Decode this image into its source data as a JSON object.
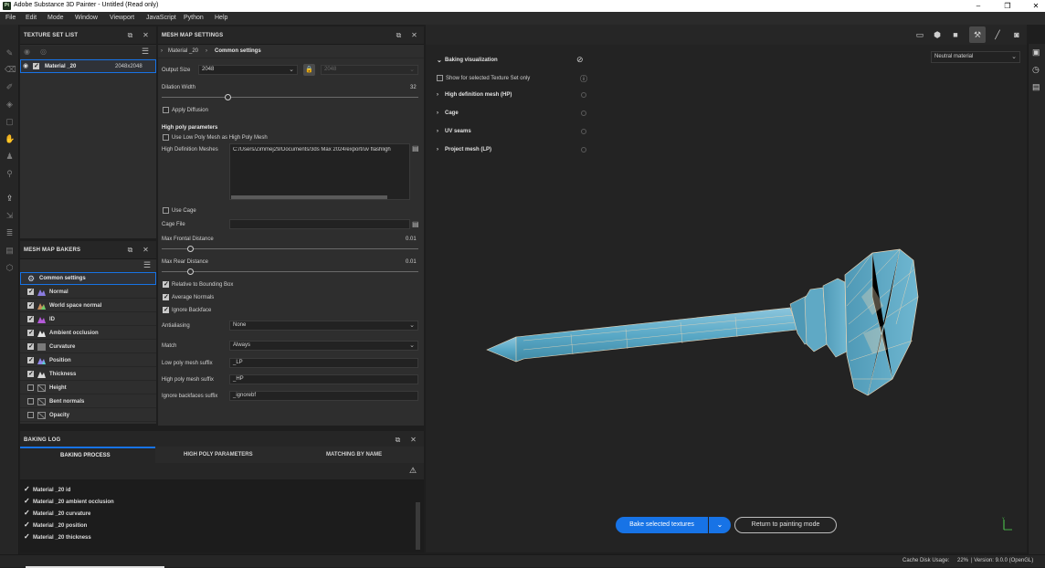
{
  "window": {
    "app_icon": "Pt",
    "title": "Adobe Substance 3D Painter - Untitled (Read only)"
  },
  "menu": [
    "File",
    "Edit",
    "Mode",
    "Window",
    "Viewport",
    "JavaScript",
    "Python",
    "Help"
  ],
  "texture_set_list": {
    "title": "TEXTURE SET LIST",
    "material_name": "Material _20",
    "material_size": "2048x2048"
  },
  "mesh_map_bakers": {
    "title": "MESH MAP BAKERS",
    "common_settings": "Common settings",
    "items": [
      {
        "label": "Normal",
        "checked": true,
        "icon": "normal-map-icon"
      },
      {
        "label": "World space normal",
        "checked": true,
        "icon": "world-normal-icon"
      },
      {
        "label": "ID",
        "checked": true,
        "icon": "id-map-icon"
      },
      {
        "label": "Ambient occlusion",
        "checked": true,
        "icon": "ao-icon"
      },
      {
        "label": "Curvature",
        "checked": true,
        "icon": "curvature-icon"
      },
      {
        "label": "Position",
        "checked": true,
        "icon": "position-icon"
      },
      {
        "label": "Thickness",
        "checked": true,
        "icon": "thickness-icon"
      },
      {
        "label": "Height",
        "checked": false,
        "icon": "height-icon"
      },
      {
        "label": "Bent normals",
        "checked": false,
        "icon": "bent-normals-icon"
      },
      {
        "label": "Opacity",
        "checked": false,
        "icon": "opacity-icon"
      }
    ]
  },
  "mesh_map_settings": {
    "title": "MESH MAP SETTINGS",
    "breadcrumb_root": "Material _20",
    "breadcrumb_current": "Common settings",
    "output_size_label": "Output Size",
    "output_size_value": "2048",
    "output_size_locked_value": "2048",
    "dilation_width_label": "Dilation Width",
    "dilation_width_value": "32",
    "apply_diffusion_label": "Apply Diffusion",
    "apply_diffusion": false,
    "high_poly_section": "High poly parameters",
    "use_low_poly_label": "Use Low Poly Mesh as High Poly Mesh",
    "use_low_poly": false,
    "hd_meshes_label": "High Definition Meshes",
    "hd_meshes_value": "C:/Users/Zimmej29/Documents/3ds Max 2024/export/uv flashligh",
    "use_cage_label": "Use Cage",
    "use_cage": false,
    "cage_file_label": "Cage File",
    "cage_file_value": "",
    "max_frontal_label": "Max Frontal Distance",
    "max_frontal_value": "0.01",
    "max_rear_label": "Max Rear Distance",
    "max_rear_value": "0.01",
    "relative_bbox_label": "Relative to Bounding Box",
    "relative_bbox": true,
    "average_normals_label": "Average Normals",
    "average_normals": true,
    "ignore_backface_label": "Ignore Backface",
    "ignore_backface": true,
    "antialiasing_label": "Antialiasing",
    "antialiasing_value": "None",
    "match_label": "Match",
    "match_value": "Always",
    "low_suffix_label": "Low poly mesh suffix",
    "low_suffix_value": "_LP",
    "high_suffix_label": "High poly mesh suffix",
    "high_suffix_value": "_HP",
    "ignore_backfaces_suffix_label": "Ignore backfaces suffix",
    "ignore_backfaces_suffix_value": "_ignorebf"
  },
  "baking_log": {
    "title": "BAKING LOG",
    "tabs": [
      "BAKING PROCESS",
      "HIGH POLY PARAMETERS",
      "MATCHING BY NAME"
    ],
    "active_tab": 0,
    "entries": [
      "Material _20 id",
      "Material _20 ambient occlusion",
      "Material _20 curvature",
      "Material _20 position",
      "Material _20 thickness"
    ]
  },
  "viewport": {
    "material_mode": "Neutral material",
    "baking_visualization": "Baking visualization",
    "show_selected_label": "Show for selected Texture Set only",
    "sections": [
      "High definition mesh (HP)",
      "Cage",
      "UV seams",
      "Project mesh (LP)"
    ],
    "bake_button": "Bake selected textures",
    "return_button": "Return to painting mode",
    "axis_label": "Y"
  },
  "status": {
    "cache_label": "Cache Disk Usage:",
    "cache_value": "22%",
    "version": "| Version: 9.0.0 (OpenGL)"
  },
  "colors": {
    "accent": "#1773e6",
    "mesh_fill": "#5aa9c7",
    "mesh_wire": "#e8d6b8"
  }
}
